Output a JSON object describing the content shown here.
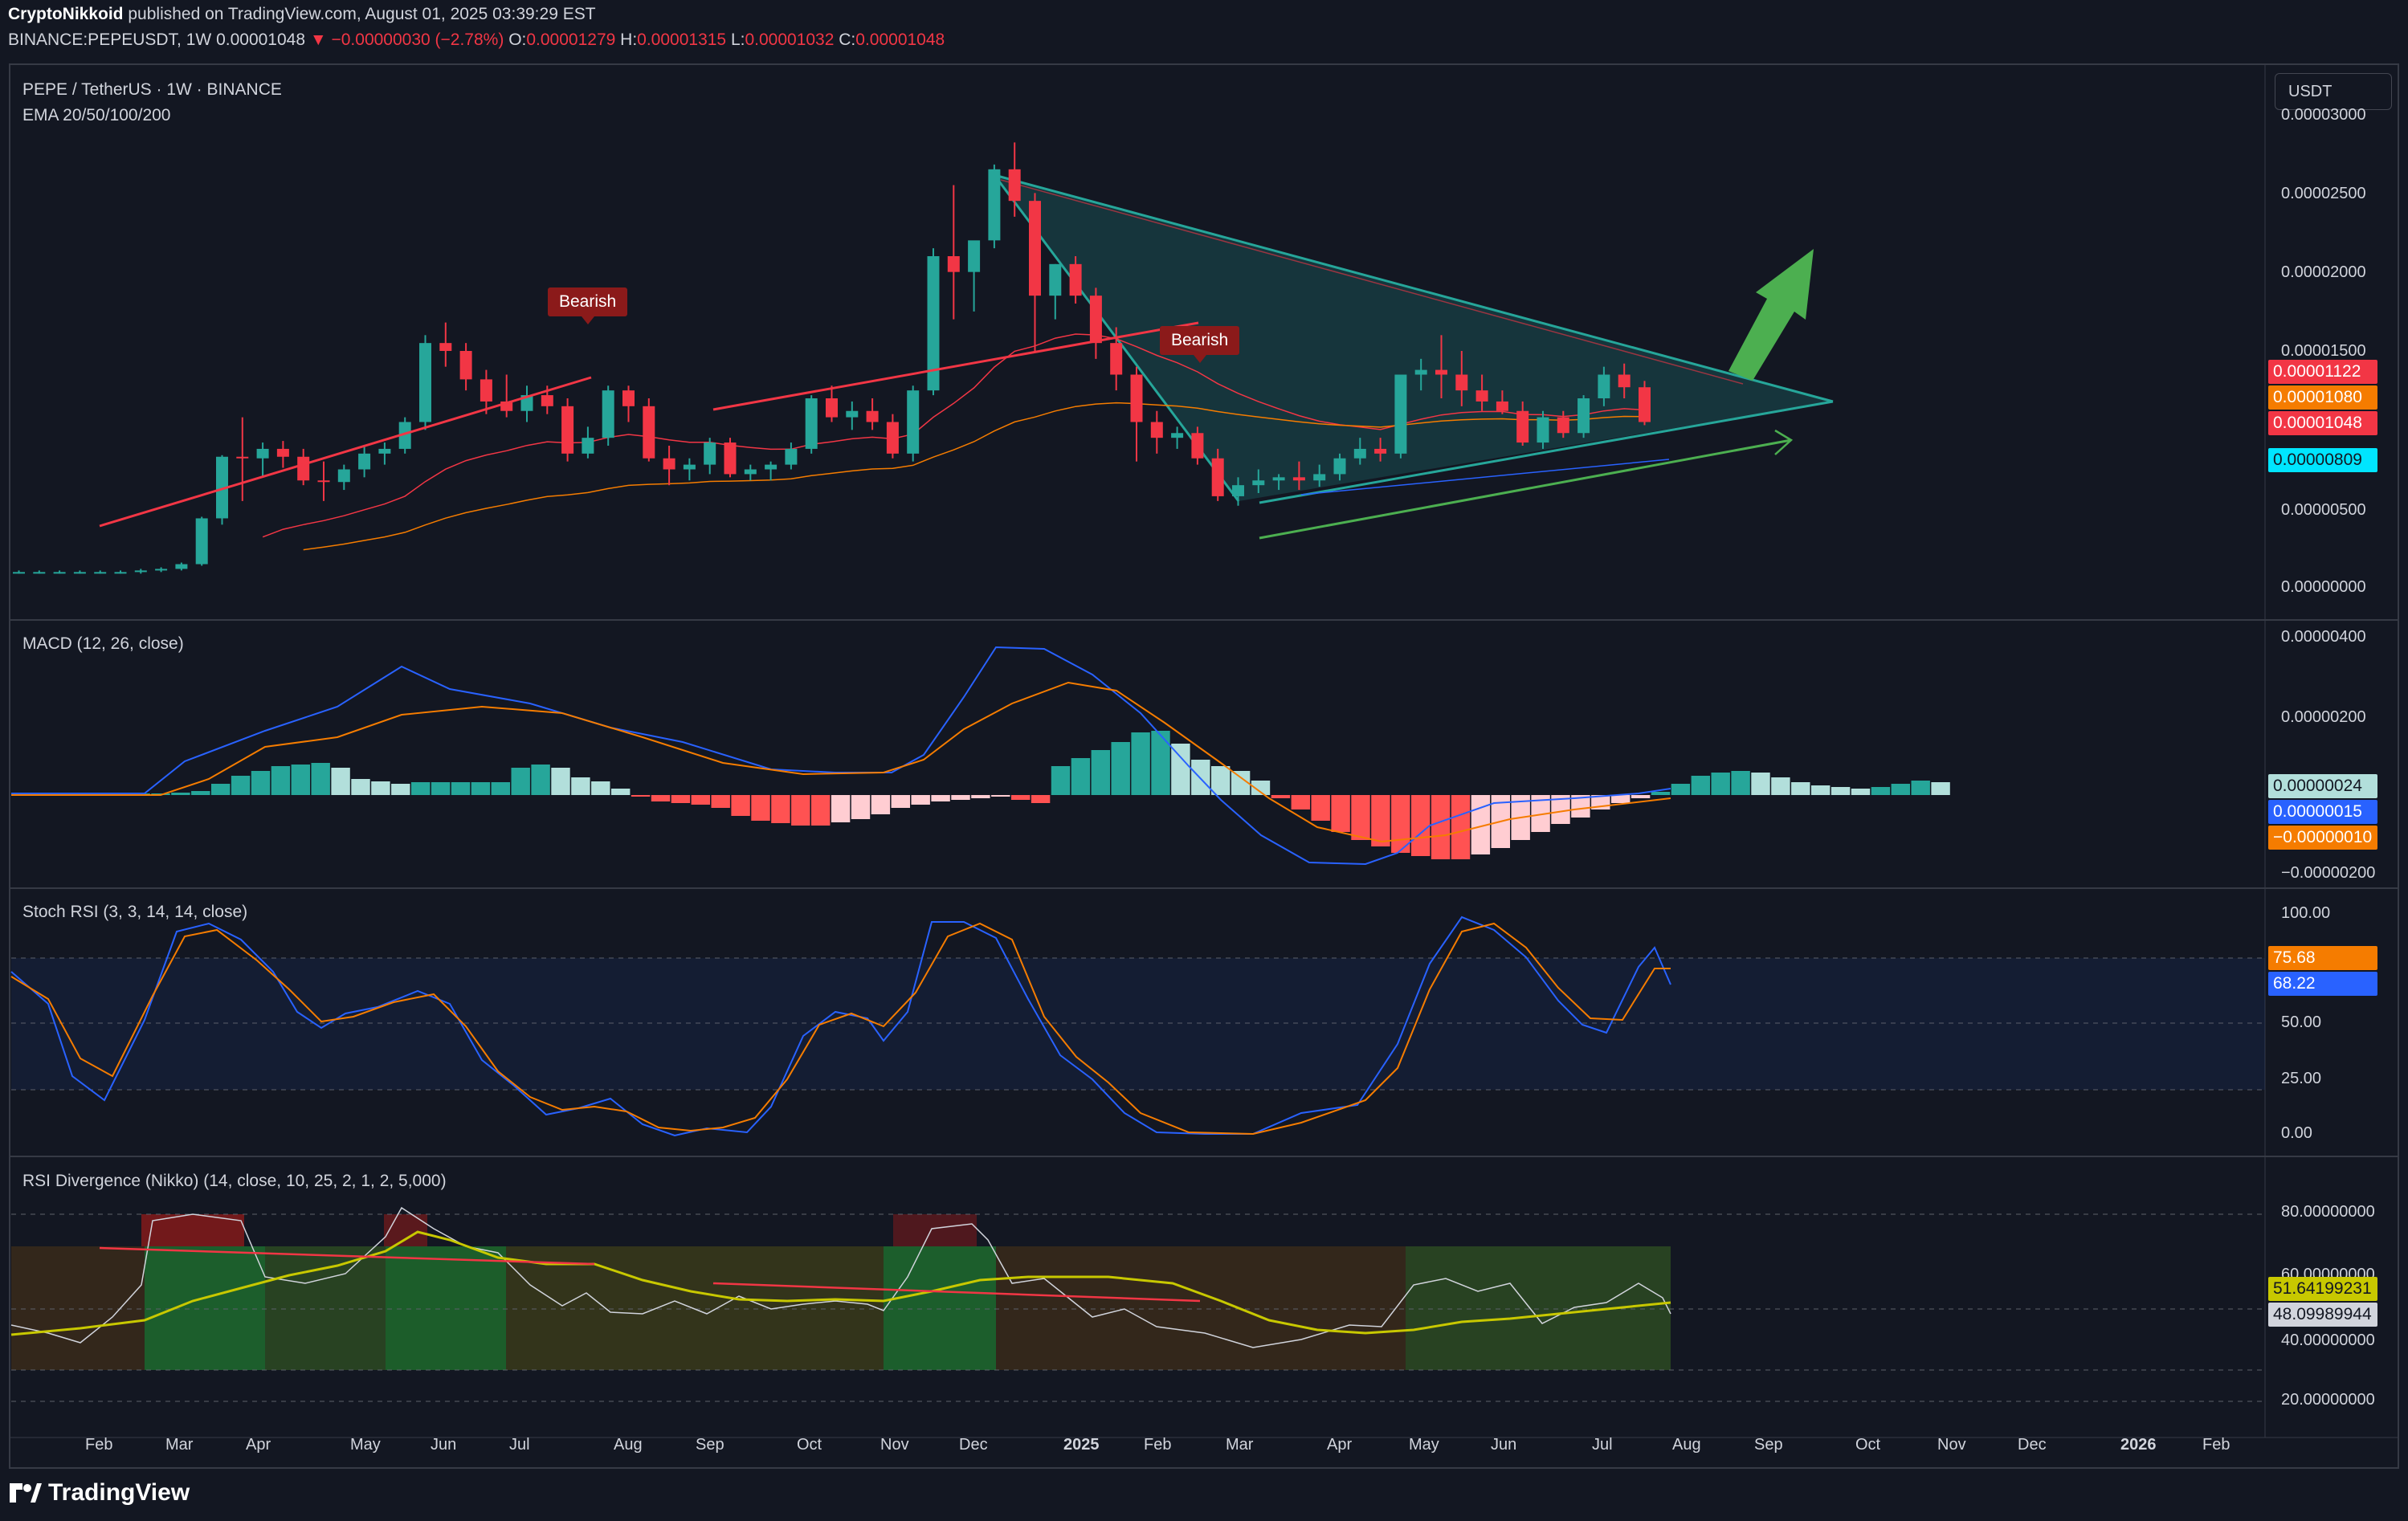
{
  "header": {
    "author": "CryptoNikkoid",
    "published": "published on TradingView.com, August 01, 2025 03:39:29 EST",
    "symbol": "BINANCE:PEPEUSDT, 1W",
    "last": "0.00001048",
    "change": "▼ −0.00000030 (−2.78%)",
    "o_label": "O:",
    "o_value": "0.00001279",
    "h_label": "H:",
    "h_value": "0.00001315",
    "l_label": "L:",
    "l_value": "0.00001032",
    "c_label": "C:",
    "c_value": "0.00001048"
  },
  "main": {
    "title": "PEPE / TetherUS · 1W · BINANCE",
    "indicator": "EMA 20/50/100/200",
    "currency_button": "USDT",
    "axis_ticks": [
      "0.00003000",
      "0.00002500",
      "0.00002000",
      "0.00001500",
      "0.00000500",
      "0.00000000"
    ],
    "price_labels": [
      {
        "text": "0.00001122",
        "color": "#f23645"
      },
      {
        "text": "0.00001080",
        "color": "#f57c00"
      },
      {
        "text": "0.00001048",
        "color": "#f23645"
      },
      {
        "text": "0.00000809",
        "color": "#00e5ff"
      }
    ],
    "annotations": [
      "Bearish",
      "Bearish"
    ]
  },
  "macd": {
    "title": "MACD (12, 26, close)",
    "axis_ticks": [
      "0.00000400",
      "0.00000200",
      "−0.00000200"
    ],
    "price_labels": [
      {
        "text": "0.00000024",
        "color": "#b2dfdb"
      },
      {
        "text": "0.00000015",
        "color": "#2962ff"
      },
      {
        "text": "−0.00000010",
        "color": "#f57c00"
      }
    ]
  },
  "stoch": {
    "title": "Stoch RSI (3, 3, 14, 14, close)",
    "axis_ticks": [
      "100.00",
      "50.00",
      "25.00",
      "0.00"
    ],
    "price_labels": [
      {
        "text": "75.68",
        "color": "#f57c00"
      },
      {
        "text": "68.22",
        "color": "#2962ff"
      }
    ]
  },
  "rsi": {
    "title": "RSI Divergence (Nikko) (14, close, 10, 25, 2, 1, 2, 5,000)",
    "axis_ticks": [
      "80.00000000",
      "60.00000000",
      "40.00000000",
      "20.00000000"
    ],
    "price_labels": [
      {
        "text": "51.64199231",
        "color": "#c8c800"
      },
      {
        "text": "48.09989944",
        "color": "#d1d4dc"
      }
    ]
  },
  "time_axis": [
    "Feb",
    "Mar",
    "Apr",
    "May",
    "Jun",
    "Jul",
    "Aug",
    "Sep",
    "Oct",
    "Nov",
    "Dec",
    "2025",
    "Feb",
    "Mar",
    "Apr",
    "May",
    "Jun",
    "Jul",
    "Aug",
    "Sep",
    "Oct",
    "Nov",
    "Dec",
    "2026",
    "Feb"
  ],
  "footer": {
    "logo": "TradingView"
  },
  "colors": {
    "bull": "#26a69a",
    "bear": "#f23645",
    "background": "#131722",
    "triangle": "#26a69a",
    "arrow": "#4caf50"
  },
  "chart_data": {
    "type": "candlestick",
    "title": "PEPE / TetherUS · 1W · BINANCE",
    "ylim": [
      0,
      3e-05
    ],
    "candles": [
      [
        1e-06,
        1.1e-06,
        9e-07,
        1e-06
      ],
      [
        1e-06,
        1.1e-06,
        9e-07,
        1e-06
      ],
      [
        1e-06,
        1.1e-06,
        9e-07,
        1e-06
      ],
      [
        1e-06,
        1.1e-06,
        9e-07,
        1e-06
      ],
      [
        1e-06,
        1.1e-06,
        9e-07,
        1e-06
      ],
      [
        1e-06,
        1.1e-06,
        9e-07,
        1e-06
      ],
      [
        1e-06,
        1.2e-06,
        9e-07,
        1.1e-06
      ],
      [
        1.1e-06,
        1.3e-06,
        1e-06,
        1.2e-06
      ],
      [
        1.2e-06,
        1.6e-06,
        1.1e-06,
        1.5e-06
      ],
      [
        1.5e-06,
        4.5e-06,
        1.4e-06,
        4.4e-06
      ],
      [
        4.4e-06,
        8.4e-06,
        4e-06,
        8.3e-06
      ],
      [
        8.3e-06,
        1.08e-05,
        5.5e-06,
        8.2e-06
      ],
      [
        8.2e-06,
        9.2e-06,
        7e-06,
        8.8e-06
      ],
      [
        8.8e-06,
        9.3e-06,
        7.6e-06,
        8.3e-06
      ],
      [
        8.3e-06,
        8.8e-06,
        6.5e-06,
        6.8e-06
      ],
      [
        6.8e-06,
        8e-06,
        5.5e-06,
        6.7e-06
      ],
      [
        6.7e-06,
        7.8e-06,
        6.2e-06,
        7.5e-06
      ],
      [
        7.5e-06,
        9e-06,
        7e-06,
        8.5e-06
      ],
      [
        8.5e-06,
        9.2e-06,
        7.8e-06,
        8.8e-06
      ],
      [
        8.8e-06,
        1.08e-05,
        8.5e-06,
        1.05e-05
      ],
      [
        1.05e-05,
        1.6e-05,
        1e-05,
        1.55e-05
      ],
      [
        1.55e-05,
        1.68e-05,
        1.4e-05,
        1.5e-05
      ],
      [
        1.5e-05,
        1.55e-05,
        1.25e-05,
        1.32e-05
      ],
      [
        1.32e-05,
        1.38e-05,
        1.1e-05,
        1.18e-05
      ],
      [
        1.18e-05,
        1.35e-05,
        1.08e-05,
        1.12e-05
      ],
      [
        1.12e-05,
        1.28e-05,
        1.05e-05,
        1.22e-05
      ],
      [
        1.22e-05,
        1.28e-05,
        1.1e-05,
        1.15e-05
      ],
      [
        1.15e-05,
        1.2e-05,
        8e-06,
        8.5e-06
      ],
      [
        8.5e-06,
        1.02e-05,
        8.2e-06,
        9.5e-06
      ],
      [
        9.5e-06,
        1.28e-05,
        9e-06,
        1.25e-05
      ],
      [
        1.25e-05,
        1.28e-05,
        1.05e-05,
        1.15e-05
      ],
      [
        1.15e-05,
        1.2e-05,
        8e-06,
        8.2e-06
      ],
      [
        8.2e-06,
        9e-06,
        6.5e-06,
        7.5e-06
      ],
      [
        7.5e-06,
        8.2e-06,
        6.8e-06,
        7.8e-06
      ],
      [
        7.8e-06,
        9.5e-06,
        7.2e-06,
        9.2e-06
      ],
      [
        9.2e-06,
        9.5e-06,
        7e-06,
        7.2e-06
      ],
      [
        7.2e-06,
        7.8e-06,
        6.8e-06,
        7.5e-06
      ],
      [
        7.5e-06,
        8e-06,
        6.8e-06,
        7.8e-06
      ],
      [
        7.8e-06,
        9.2e-06,
        7.5e-06,
        8.8e-06
      ],
      [
        8.8e-06,
        1.22e-05,
        8.5e-06,
        1.2e-05
      ],
      [
        1.2e-05,
        1.28e-05,
        1.05e-05,
        1.08e-05
      ],
      [
        1.08e-05,
        1.18e-05,
        1e-05,
        1.12e-05
      ],
      [
        1.12e-05,
        1.2e-05,
        1e-05,
        1.05e-05
      ],
      [
        1.05e-05,
        1.1e-05,
        8.2e-06,
        8.5e-06
      ],
      [
        8.5e-06,
        1.28e-05,
        8e-06,
        1.25e-05
      ],
      [
        1.25e-05,
        2.15e-05,
        1.22e-05,
        2.1e-05
      ],
      [
        2.1e-05,
        2.55e-05,
        1.7e-05,
        2e-05
      ],
      [
        2e-05,
        2.15e-05,
        1.75e-05,
        2.2e-05
      ],
      [
        2.2e-05,
        2.68e-05,
        2.15e-05,
        2.65e-05
      ],
      [
        2.65e-05,
        2.82e-05,
        2.35e-05,
        2.45e-05
      ],
      [
        2.45e-05,
        2.5e-05,
        1.5e-05,
        1.85e-05
      ],
      [
        1.85e-05,
        2.05e-05,
        1.7e-05,
        2.05e-05
      ],
      [
        2.05e-05,
        2.1e-05,
        1.8e-05,
        1.85e-05
      ],
      [
        1.85e-05,
        1.9e-05,
        1.45e-05,
        1.55e-05
      ],
      [
        1.55e-05,
        1.65e-05,
        1.25e-05,
        1.35e-05
      ],
      [
        1.35e-05,
        1.4e-05,
        8e-06,
        1.05e-05
      ],
      [
        1.05e-05,
        1.12e-05,
        8.5e-06,
        9.5e-06
      ],
      [
        9.5e-06,
        1.02e-05,
        8.8e-06,
        9.8e-06
      ],
      [
        9.8e-06,
        1.02e-05,
        7.8e-06,
        8.2e-06
      ],
      [
        8.2e-06,
        8.8e-06,
        5.5e-06,
        5.8e-06
      ],
      [
        5.8e-06,
        7e-06,
        5.2e-06,
        6.5e-06
      ],
      [
        6.5e-06,
        7.5e-06,
        6e-06,
        6.8e-06
      ],
      [
        6.8e-06,
        7.2e-06,
        6.2e-06,
        7e-06
      ],
      [
        7e-06,
        8e-06,
        6.2e-06,
        6.8e-06
      ],
      [
        6.8e-06,
        7.8e-06,
        6.4e-06,
        7.2e-06
      ],
      [
        7.2e-06,
        8.5e-06,
        6.8e-06,
        8.2e-06
      ],
      [
        8.2e-06,
        9.5e-06,
        7.8e-06,
        8.8e-06
      ],
      [
        8.8e-06,
        9.5e-06,
        8e-06,
        8.5e-06
      ],
      [
        8.5e-06,
        1.35e-05,
        8.2e-06,
        1.35e-05
      ],
      [
        1.35e-05,
        1.45e-05,
        1.25e-05,
        1.38e-05
      ],
      [
        1.38e-05,
        1.6e-05,
        1.2e-05,
        1.35e-05
      ],
      [
        1.35e-05,
        1.5e-05,
        1.15e-05,
        1.25e-05
      ],
      [
        1.25e-05,
        1.35e-05,
        1.12e-05,
        1.18e-05
      ],
      [
        1.18e-05,
        1.25e-05,
        1.1e-05,
        1.12e-05
      ],
      [
        1.12e-05,
        1.18e-05,
        9e-06,
        9.2e-06
      ],
      [
        9.2e-06,
        1.12e-05,
        8.8e-06,
        1.08e-05
      ],
      [
        1.08e-05,
        1.12e-05,
        9.5e-06,
        9.8e-06
      ],
      [
        9.8e-06,
        1.22e-05,
        9.5e-06,
        1.2e-05
      ],
      [
        1.2e-05,
        1.4e-05,
        1.15e-05,
        1.35e-05
      ],
      [
        1.35e-05,
        1.42e-05,
        1.2e-05,
        1.27e-05
      ],
      [
        1.27e-05,
        1.31e-05,
        1.03e-05,
        1.05e-05
      ]
    ]
  }
}
